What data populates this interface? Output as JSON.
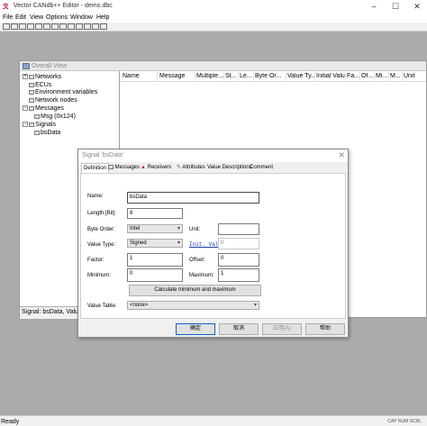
{
  "app": {
    "title": "Vector CANdb++ Editor - demo.dbc",
    "controls": {
      "minimize": "–",
      "maximize": "☐",
      "close": "✕"
    }
  },
  "menu": [
    "File",
    "Edit",
    "View",
    "Options",
    "Window",
    "Help"
  ],
  "overall_view": {
    "title": "Overall View",
    "tree": [
      {
        "label": "Networks",
        "level": 0,
        "expander": "+"
      },
      {
        "label": "ECUs",
        "level": 0,
        "expander": ""
      },
      {
        "label": "Environment variables",
        "level": 0,
        "expander": ""
      },
      {
        "label": "Network nodes",
        "level": 0,
        "expander": ""
      },
      {
        "label": "Messages",
        "level": 0,
        "expander": "−"
      },
      {
        "label": "Msg (0x124)",
        "level": 1,
        "expander": ""
      },
      {
        "label": "Signals",
        "level": 0,
        "expander": "−"
      },
      {
        "label": "bsData",
        "level": 1,
        "expander": ""
      }
    ],
    "columns": [
      "Name",
      "Message",
      "Multiple...",
      "St...",
      "Le...",
      "Byte Or...",
      "Value Ty...",
      "Initial Valu...",
      "Fa...",
      "Of...",
      "Mi...",
      "M...",
      "Unit"
    ],
    "bottom_text": "Signal: bsData,  Value"
  },
  "dialog": {
    "title": "Signal 'bsData'",
    "close": "✕",
    "tabs": [
      "Definition",
      "Messages",
      "Receivers",
      "Attributes",
      "Value Descriptions",
      "Comment"
    ],
    "fields": {
      "name": {
        "label": "Name:",
        "value": "bsData"
      },
      "length": {
        "label": "Length [Bit]:",
        "value": "8"
      },
      "byte_order": {
        "label": "Byte Order:",
        "value": "Intel"
      },
      "unit": {
        "label": "Unit:",
        "value": ""
      },
      "value_type": {
        "label": "Value Type:",
        "value": "Signed"
      },
      "init_value": {
        "label": "Init. Value",
        "value": "0"
      },
      "factor": {
        "label": "Factor:",
        "value": "1"
      },
      "offset": {
        "label": "Offset:",
        "value": "0"
      },
      "minimum": {
        "label": "Minimum:",
        "value": "0"
      },
      "maximum": {
        "label": "Maximum:",
        "value": "1"
      },
      "value_table": {
        "label": "Value Table:",
        "value": "<none>"
      }
    },
    "calc_button": "Calculate minimum and maximum",
    "buttons": {
      "ok": "确定",
      "cancel": "取消",
      "apply": "应用(A)",
      "help": "帮助"
    }
  },
  "statusbar": {
    "text": "Ready",
    "indicator": "CAP NUM SCRL"
  }
}
